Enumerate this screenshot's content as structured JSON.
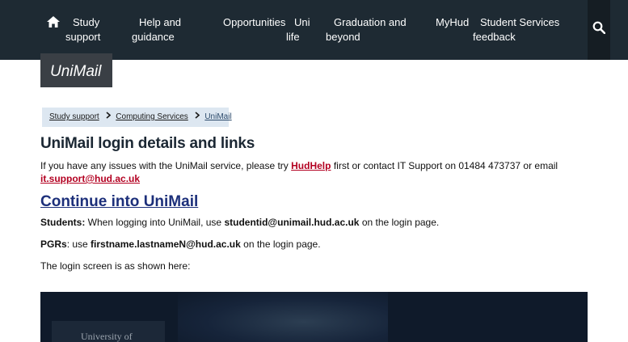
{
  "nav": {
    "items": [
      {
        "line1": "Study",
        "line2": "support"
      },
      {
        "line1": "Help and",
        "line2": "guidance"
      },
      {
        "line1": "Opportunities",
        "line2": ""
      },
      {
        "line1": "Uni",
        "line2": "life"
      },
      {
        "line1": "Graduation and",
        "line2": "beyond"
      },
      {
        "line1": "MyHud",
        "line2": ""
      },
      {
        "line1": "Student Services",
        "line2": "feedback"
      }
    ]
  },
  "site_title": "UniMail",
  "breadcrumb": {
    "items": [
      "Study support",
      "Computing Services",
      "UniMail"
    ]
  },
  "main": {
    "heading": "UniMail login details and links",
    "intro_before": "If you have any issues with the UniMail service, please try ",
    "hudhelp_link": "HudHelp",
    "intro_middle": " first or contact IT Support on 01484 473737 or email",
    "email_link": "it.support@hud.ac.uk",
    "continue_link": "Continue into UniMail",
    "students_label": "Students:",
    "students_text_before": " When logging into UniMail, use ",
    "students_login": "studentid@unimail.hud.ac.uk",
    "students_text_after": " on the login page.",
    "pgrs_label": "PGRs",
    "pgrs_text_before": ": use ",
    "pgrs_login": "firstname.lastnameN@hud.ac.uk",
    "pgrs_text_after": " on the login page.",
    "login_screen_note": "The login screen is as shown here:"
  },
  "login_image": {
    "partial_text": "University of"
  },
  "colors": {
    "nav_background": "#1e2a33",
    "site_title_background": "#3a3f45",
    "breadcrumb_background": "#dde7f1",
    "link_red": "#b30021",
    "continue_link": "#1c2f7a"
  }
}
